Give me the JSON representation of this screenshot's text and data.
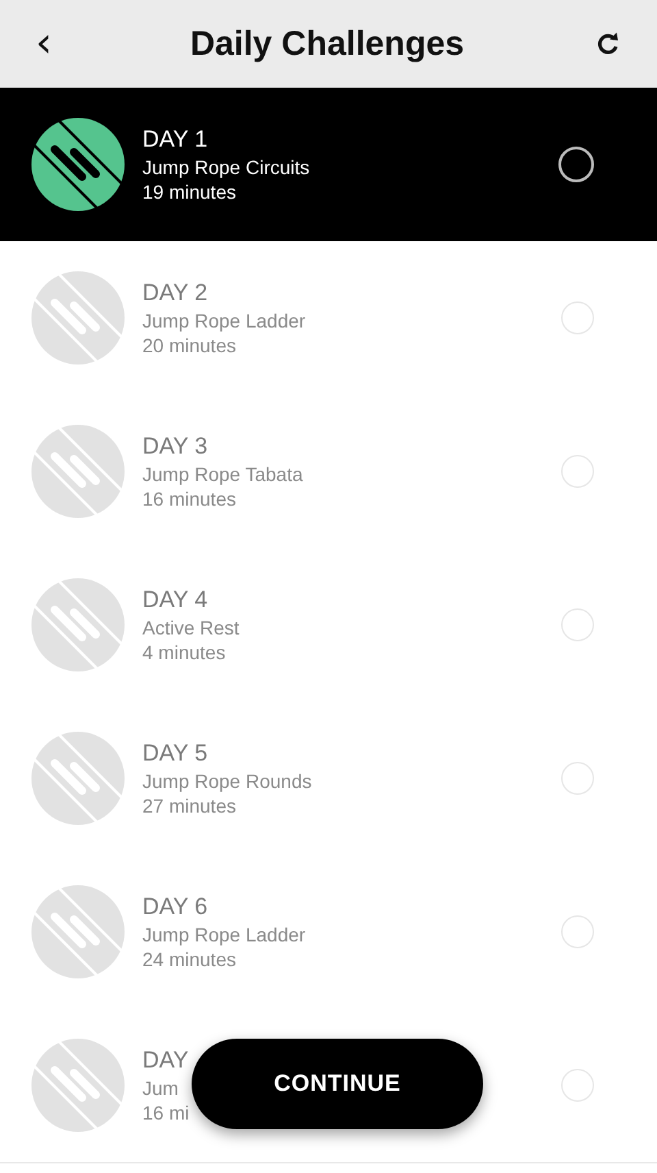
{
  "header": {
    "back": "‹",
    "title": "Daily Challenges"
  },
  "days": [
    {
      "day": "DAY 1",
      "name": "Jump Rope Circuits",
      "duration": "19 minutes",
      "selected": true
    },
    {
      "day": "DAY 2",
      "name": "Jump Rope Ladder",
      "duration": "20 minutes",
      "selected": false
    },
    {
      "day": "DAY 3",
      "name": "Jump Rope Tabata",
      "duration": "16 minutes",
      "selected": false
    },
    {
      "day": "DAY 4",
      "name": "Active Rest",
      "duration": "4 minutes",
      "selected": false
    },
    {
      "day": "DAY 5",
      "name": "Jump Rope Rounds",
      "duration": "27 minutes",
      "selected": false
    },
    {
      "day": "DAY 6",
      "name": "Jump Rope Ladder",
      "duration": "24 minutes",
      "selected": false
    },
    {
      "day": "DAY",
      "name": "Jum",
      "duration": "16 mi",
      "selected": false
    }
  ],
  "continue_button": "CONTINUE"
}
